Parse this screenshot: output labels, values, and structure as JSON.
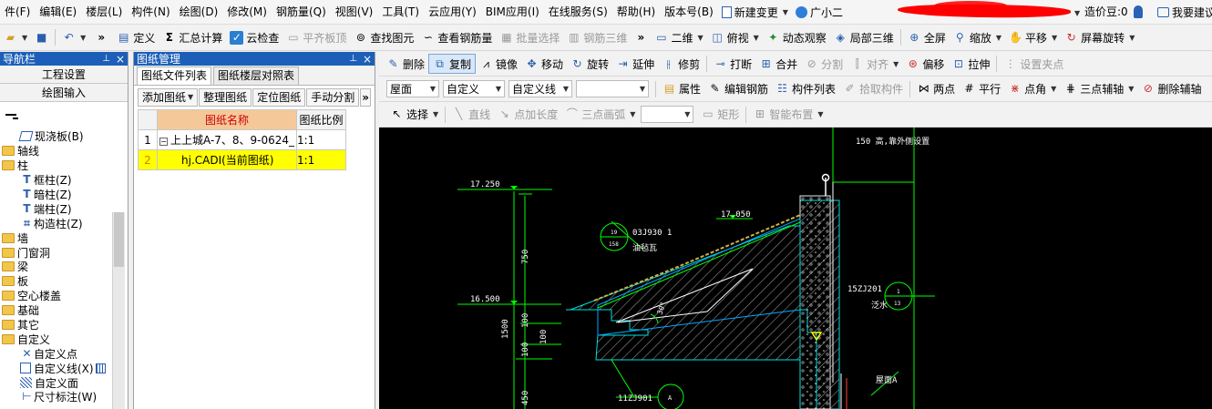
{
  "menubar": {
    "items": [
      "件(F)",
      "编辑(E)",
      "楼层(L)",
      "构件(N)",
      "绘图(D)",
      "修改(M)",
      "钢筋量(Q)",
      "视图(V)",
      "工具(T)",
      "云应用(Y)",
      "BIM应用(I)",
      "在线服务(S)",
      "帮助(H)",
      "版本号(B)"
    ],
    "new_change": "新建变更",
    "assistant": "广小二",
    "price_bean": "造价豆:0",
    "suggest": "我要建议"
  },
  "toolbar1": {
    "define": "定义",
    "summary_calc": "汇总计算",
    "cloud_check": "云检查",
    "flat_slab_top": "平齐板顶",
    "find_element": "查找图元",
    "view_rebar": "查看钢筋量",
    "batch_select": "批量选择",
    "rebar_3d": "钢筋三维",
    "view_2d": "二维",
    "top_view": "俯视",
    "dynamic_observe": "动态观察",
    "local_3d": "局部三维",
    "fullscreen": "全屏",
    "zoom": "缩放",
    "pan": "平移",
    "screen_rotate": "屏幕旋转"
  },
  "toolbar2": {
    "delete": "删除",
    "copy": "复制",
    "mirror": "镜像",
    "move": "移动",
    "rotate": "旋转",
    "extend": "延伸",
    "trim": "修剪",
    "break": "打断",
    "merge": "合并",
    "split": "分割",
    "align": "对齐",
    "offset": "偏移",
    "stretch": "拉伸",
    "set_grip": "设置夹点"
  },
  "toolbar3": {
    "combo1": "屋面",
    "combo2": "自定义",
    "combo3": "自定义线",
    "combo4": "",
    "properties": "属性",
    "edit_rebar": "编辑钢筋",
    "component_list": "构件列表",
    "pick_component": "拾取构件",
    "two_point": "两点",
    "parallel": "平行",
    "point_angle": "点角",
    "three_point_axis": "三点辅轴",
    "delete_axis": "删除辅轴"
  },
  "toolbar4": {
    "select": "选择",
    "line": "直线",
    "point_length": "点加长度",
    "three_point_arc": "三点画弧",
    "combo": "",
    "rect": "矩形",
    "smart_layout": "智能布置"
  },
  "nav": {
    "title": "导航栏",
    "pin": "ᵖ",
    "close": "×",
    "project_settings": "工程设置",
    "drawing_input": "绘图输入",
    "tree": [
      {
        "label": "现浇板(B)",
        "level": 2,
        "icon": "slab-icon"
      },
      {
        "label": "轴线",
        "level": 0,
        "icon": "folder-icon"
      },
      {
        "label": "柱",
        "level": 0,
        "icon": "folder-icon"
      },
      {
        "label": "框柱(Z)",
        "level": 2,
        "icon": "column-icon"
      },
      {
        "label": "暗柱(Z)",
        "level": 2,
        "icon": "column-icon"
      },
      {
        "label": "端柱(Z)",
        "level": 2,
        "icon": "column-icon"
      },
      {
        "label": "构造柱(Z)",
        "level": 2,
        "icon": "column-icon"
      },
      {
        "label": "墙",
        "level": 0,
        "icon": "folder-icon"
      },
      {
        "label": "门窗洞",
        "level": 0,
        "icon": "folder-icon"
      },
      {
        "label": "梁",
        "level": 0,
        "icon": "folder-icon"
      },
      {
        "label": "板",
        "level": 0,
        "icon": "folder-icon"
      },
      {
        "label": "空心楼盖",
        "level": 0,
        "icon": "folder-icon"
      },
      {
        "label": "基础",
        "level": 0,
        "icon": "folder-icon"
      },
      {
        "label": "其它",
        "level": 0,
        "icon": "folder-icon"
      },
      {
        "label": "自定义",
        "level": 0,
        "icon": "folder-icon"
      },
      {
        "label": "自定义点",
        "level": 2,
        "icon": "point-icon"
      },
      {
        "label": "自定义线(X)",
        "level": 2,
        "icon": "line-icon"
      },
      {
        "label": "自定义面",
        "level": 2,
        "icon": "face-icon"
      },
      {
        "label": "尺寸标注(W)",
        "level": 2,
        "icon": "dimension-icon"
      }
    ]
  },
  "drawings": {
    "title": "图纸管理",
    "tab_files": "图纸文件列表",
    "tab_floors": "图纸楼层对照表",
    "add": "添加图纸",
    "organize": "整理图纸",
    "locate": "定位图纸",
    "manual_split": "手动分割",
    "col_name": "图纸名称",
    "col_scale": "图纸比例",
    "rows": [
      {
        "idx": "1",
        "name": "上上城A-7、8、9-0624_",
        "scale": "1:1"
      },
      {
        "idx": "2",
        "name": "hj.CADI(当前图纸)",
        "scale": "1:1"
      }
    ]
  },
  "cad": {
    "note_top": "150 高,靠外侧设置",
    "elev1": "17.250",
    "elev2": "17.050",
    "elev3": "16.500",
    "dim_750": "750",
    "dim_1500": "1500",
    "dim_100a": "100",
    "dim_100b": "100",
    "dim_100c": "100",
    "dim_450": "450",
    "ref_code1": "03J930 1",
    "ref_circle1_top": "19",
    "ref_circle1_bottom": "158",
    "label_tile": "油毡瓦",
    "ref_code2": "15ZJ201",
    "ref_circle2_top": "1",
    "ref_circle2_bottom": "13",
    "label_flashing": "泛水",
    "slope_label": "30°",
    "ref_code3": "11ZJ901",
    "ref_circle3": "A",
    "roof_label": "屋面A"
  }
}
